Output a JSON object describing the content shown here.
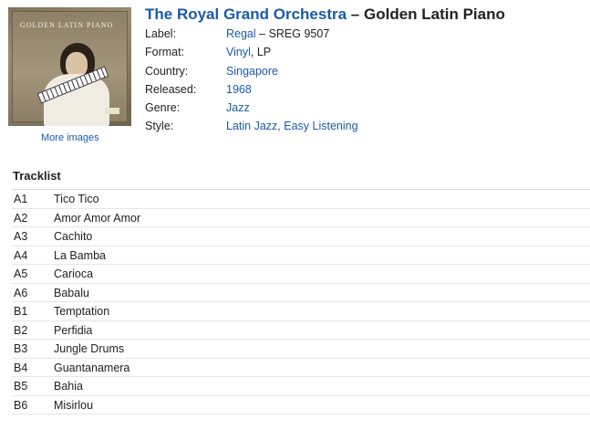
{
  "release": {
    "artist": "The Royal Grand Orchestra",
    "separator": " – ",
    "album": "Golden Latin Piano"
  },
  "cover": {
    "text": "GOLDEN LATIN PIANO",
    "more_images": "More images"
  },
  "details": {
    "label_key": "Label:",
    "label_link": "Regal",
    "label_rest": " – SREG 9507",
    "format_key": "Format:",
    "format_link": "Vinyl",
    "format_rest": ", LP",
    "country_key": "Country:",
    "country_link": "Singapore",
    "released_key": "Released:",
    "released_link": "1968",
    "genre_key": "Genre:",
    "genre_link": "Jazz",
    "style_key": "Style:",
    "style_link": "Latin Jazz, Easy Listening"
  },
  "tracklist": {
    "heading": "Tracklist",
    "tracks": [
      {
        "pos": "A1",
        "title": "Tico Tico"
      },
      {
        "pos": "A2",
        "title": "Amor Amor Amor"
      },
      {
        "pos": "A3",
        "title": "Cachito"
      },
      {
        "pos": "A4",
        "title": "La Bamba"
      },
      {
        "pos": "A5",
        "title": "Carioca"
      },
      {
        "pos": "A6",
        "title": "Babalu"
      },
      {
        "pos": "B1",
        "title": "Temptation"
      },
      {
        "pos": "B2",
        "title": "Perfidia"
      },
      {
        "pos": "B3",
        "title": "Jungle Drums"
      },
      {
        "pos": "B4",
        "title": "Guantanamera"
      },
      {
        "pos": "B5",
        "title": "Bahia"
      },
      {
        "pos": "B6",
        "title": "Misirlou"
      }
    ]
  },
  "colors": {
    "link": "#1c5aa8",
    "text": "#222222"
  }
}
